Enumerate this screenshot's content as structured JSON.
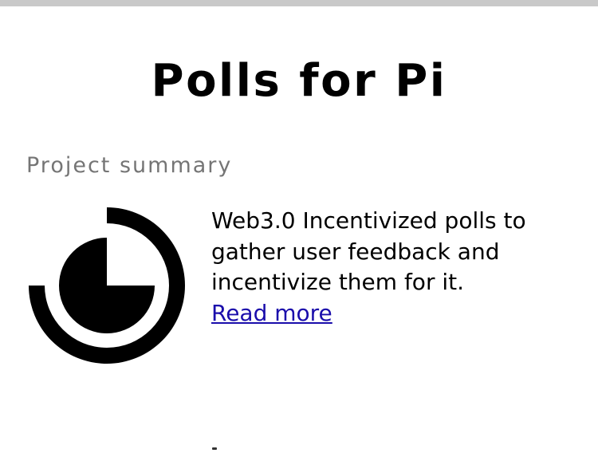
{
  "header": {
    "title": "Polls for Pi"
  },
  "summary_section": {
    "label": "Project summary",
    "logo_icon": "poll-chart-icon",
    "description": "Web3.0 Incentivized polls to gather user feedback and incentivize them for it.",
    "read_more_label": "Read more"
  },
  "colors": {
    "title": "#000000",
    "label": "#757575",
    "link": "#1a0dab",
    "top_bar": "#c9c9c9"
  }
}
